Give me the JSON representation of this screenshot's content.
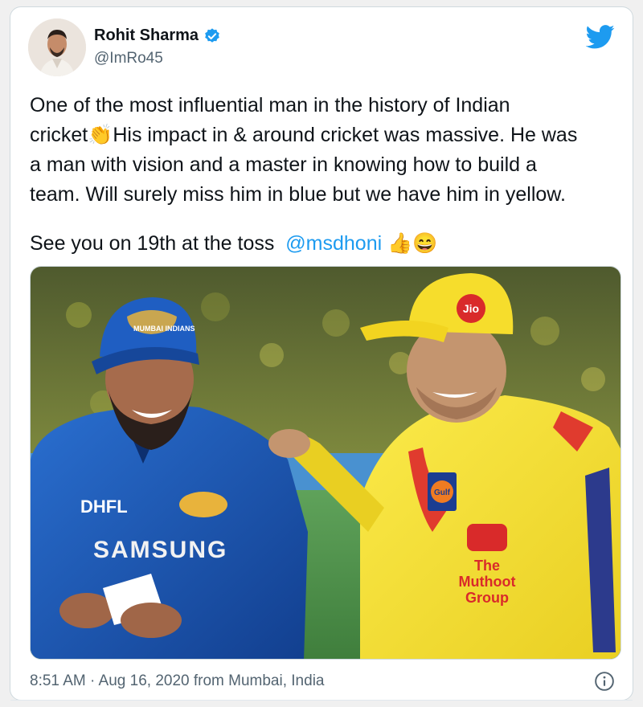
{
  "tweet": {
    "author_name": "Rohit Sharma",
    "author_handle": "@ImRo45",
    "text_line1": "One of the most influential man in the history of Indian\ncricket👏His impact in & around cricket was massive. He was\na man with vision and a master in knowing how to build a\nteam. Will surely miss him in blue but we have him in yellow.",
    "text_line2_prefix": "See you on 19th at the toss  ",
    "mention": "@msdhoni",
    "emoji_suffix": " 👍😄",
    "timestamp": "8:51 AM · Aug 16, 2020 from Mumbai, India"
  },
  "photo": {
    "left_jersey_sponsor": "SAMSUNG",
    "left_jersey_logo": "DHFL",
    "left_cap_logo": "MUMBAI INDIANS",
    "right_cap_logo": "Jio",
    "right_jersey_brand": "Gulf",
    "right_jersey_sponsor_line1": "The",
    "right_jersey_sponsor_line2": "Muthoot",
    "right_jersey_sponsor_line3": "Group"
  },
  "colors": {
    "accent": "#1d9bf0",
    "mi_blue": "#1c5bb8",
    "csk_yellow": "#f7e33c",
    "text": "#0f1419",
    "muted": "#536471"
  },
  "icons": {
    "verified": "verified-badge-icon",
    "brand": "twitter-bird-icon",
    "info": "info-icon"
  }
}
